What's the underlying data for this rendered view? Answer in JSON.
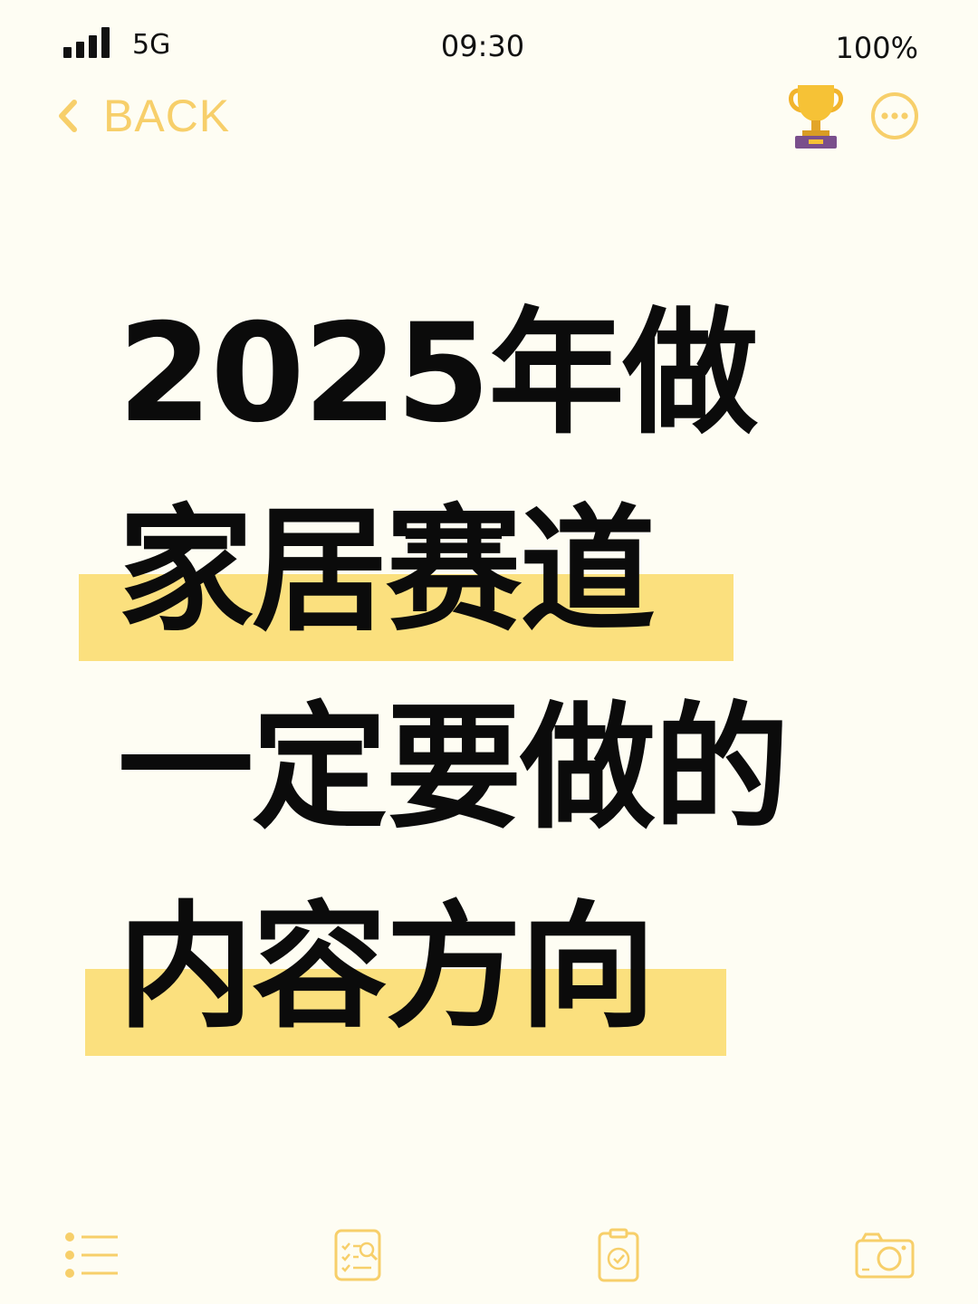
{
  "status_bar": {
    "network": "5G",
    "time": "09:30",
    "battery": "100%"
  },
  "nav": {
    "back_label": "BACK",
    "accent_color": "#F7CF6A"
  },
  "title": {
    "lines": [
      "2025年做",
      "家居赛道",
      "一定要做的",
      "内容方向"
    ],
    "highlight_color": "#FBE07E"
  },
  "toolbar": {
    "icons": [
      "list-icon",
      "checklist-search-icon",
      "clipboard-check-icon",
      "camera-icon"
    ]
  }
}
